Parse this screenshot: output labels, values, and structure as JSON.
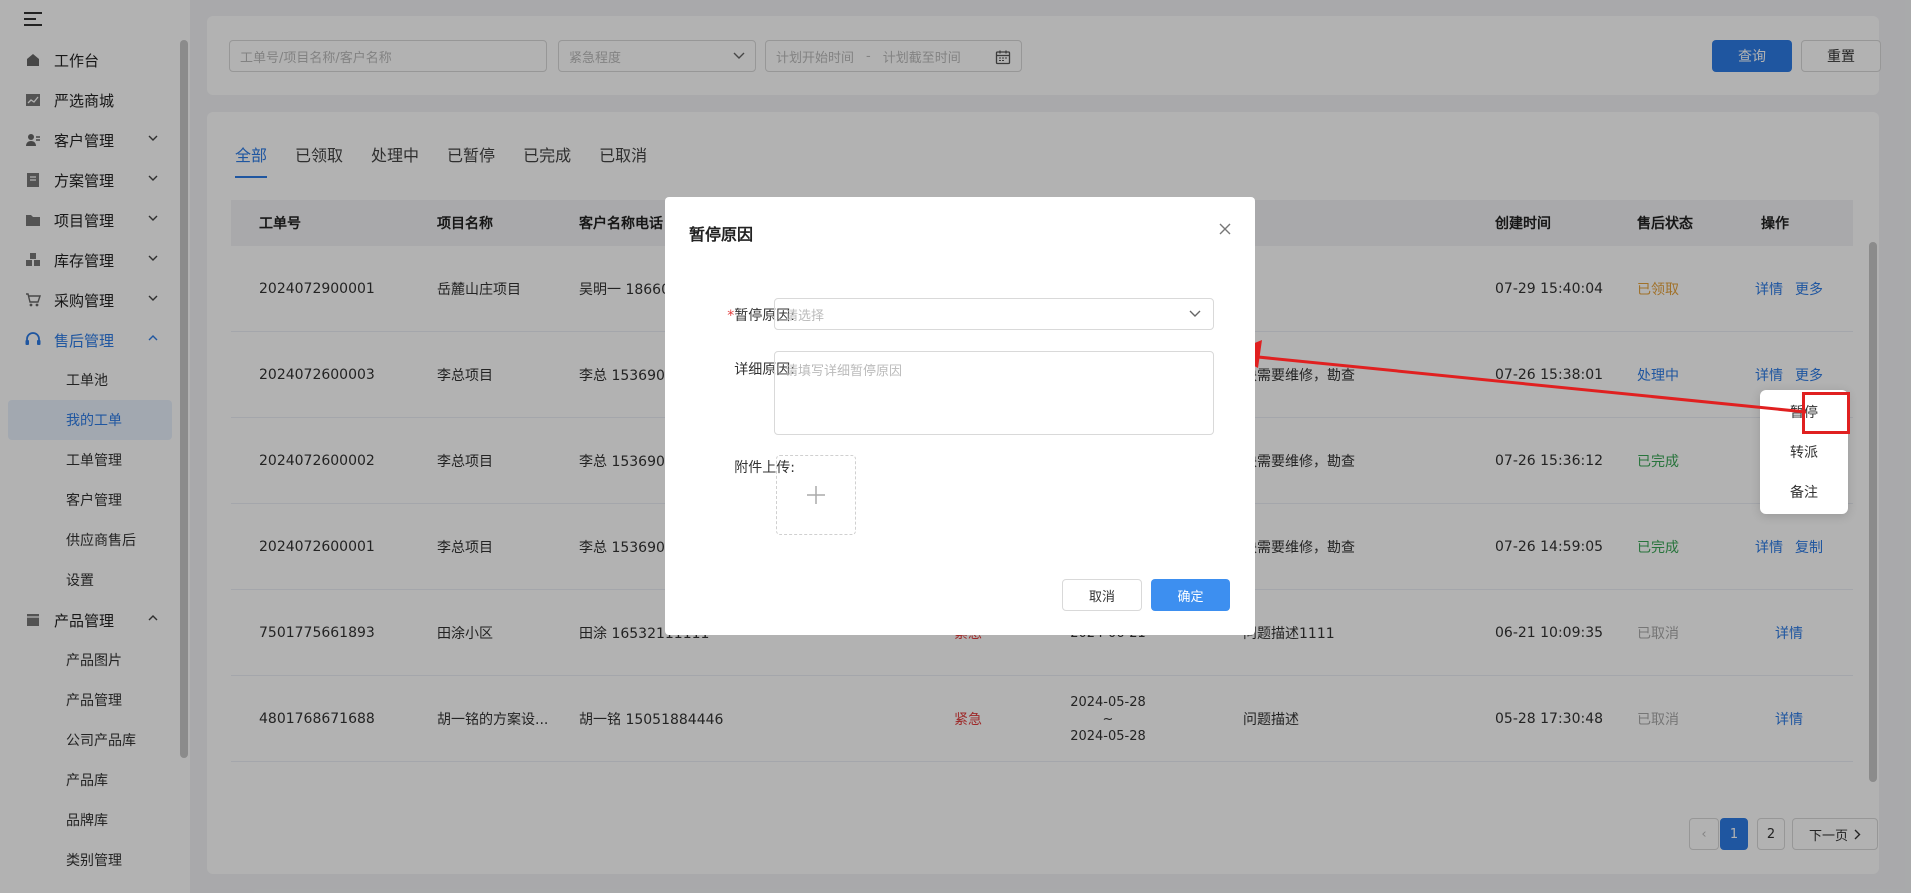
{
  "sidebar": {
    "top_items": [
      {
        "label": "工作台",
        "icon": "home-icon"
      },
      {
        "label": "严选商城",
        "icon": "chart-icon"
      },
      {
        "label": "客户管理",
        "icon": "user-icon"
      },
      {
        "label": "方案管理",
        "icon": "doc-icon"
      },
      {
        "label": "项目管理",
        "icon": "folder-icon"
      },
      {
        "label": "库存管理",
        "icon": "box-icon"
      },
      {
        "label": "采购管理",
        "icon": "cart-icon"
      },
      {
        "label": "售后管理",
        "icon": "headset-icon"
      }
    ],
    "aftersale_sub": [
      "工单池",
      "我的工单",
      "工单管理",
      "客户管理",
      "供应商售后",
      "设置"
    ],
    "product_label": "产品管理",
    "product_sub": [
      "产品图片",
      "产品管理",
      "公司产品库",
      "产品库",
      "品牌库",
      "类别管理"
    ]
  },
  "search": {
    "keyword_placeholder": "工单号/项目名称/客户名称",
    "urgency_placeholder": "紧急程度",
    "start_placeholder": "计划开始时间",
    "separator": "-",
    "end_placeholder": "计划截至时间",
    "query_label": "查询",
    "reset_label": "重置"
  },
  "tabs": [
    "全部",
    "已领取",
    "处理中",
    "已暂停",
    "已完成",
    "已取消"
  ],
  "table": {
    "headers": {
      "order_no": "工单号",
      "project": "项目名称",
      "customer": "客户名称电话",
      "created": "创建时间",
      "status": "售后状态",
      "actions": "操作"
    },
    "rows": [
      {
        "order_no": "2024072900001",
        "project": "岳麓山庄项目",
        "customer": "吴明一  18660",
        "urgency": "",
        "plan_start": "",
        "plan_end": "",
        "desc": "",
        "created": "07-29 15:40:04",
        "status": "已领取",
        "status_class": "st-orange",
        "act1": "详情",
        "act2": "更多"
      },
      {
        "order_no": "2024072600003",
        "project": "李总项目",
        "customer": "李总  153690",
        "urgency": "",
        "plan_start": "",
        "plan_end": "",
        "desc": "块需要维修，勘查",
        "created": "07-26 15:38:01",
        "status": "处理中",
        "status_class": "st-blue",
        "act1": "详情",
        "act2": "更多"
      },
      {
        "order_no": "2024072600002",
        "project": "李总项目",
        "customer": "李总  153690",
        "urgency": "",
        "plan_start": "",
        "plan_end": "",
        "desc": "块需要维修，勘查",
        "created": "07-26 15:36:12",
        "status": "已完成",
        "status_class": "st-green",
        "act1": "",
        "act2": ""
      },
      {
        "order_no": "2024072600001",
        "project": "李总项目",
        "customer": "李总  153690",
        "urgency": "",
        "plan_start": "",
        "plan_end": "",
        "desc": "块需要维修，勘查",
        "created": "07-26 14:59:05",
        "status": "已完成",
        "status_class": "st-green",
        "act1": "详情",
        "act2": "复制"
      },
      {
        "order_no": "7501775661893",
        "project": "田涂小区",
        "customer": "田涂  16532111111",
        "urgency": "紧急",
        "plan_start": "",
        "plan_end": "2024-06-21",
        "desc": "问题描述1111",
        "created": "06-21 10:09:35",
        "status": "已取消",
        "status_class": "st-gray",
        "act1": "详情",
        "act2": ""
      },
      {
        "order_no": "4801768671688",
        "project": "胡一铭的方案设...",
        "customer": "胡一铭  15051884446",
        "urgency": "紧急",
        "plan_start": "2024-05-28",
        "plan_end": "2024-05-28",
        "desc": "问题描述",
        "created": "05-28 17:30:48",
        "status": "已取消",
        "status_class": "st-gray",
        "act1": "详情",
        "act2": ""
      }
    ],
    "tilde": "~"
  },
  "pagination": {
    "prev": "‹",
    "pages": [
      "1",
      "2"
    ],
    "next": "下一页"
  },
  "dropdown": [
    "暂停",
    "转派",
    "备注"
  ],
  "modal": {
    "title": "暂停原因",
    "reason_label": "暂停原因:",
    "reason_required": "*",
    "reason_placeholder": "请选择",
    "detail_label": "详细原因:",
    "detail_placeholder": "请填写详细暂停原因",
    "upload_label": "附件上传:",
    "cancel_label": "取消",
    "confirm_label": "确定"
  },
  "colors": {
    "primary": "#2d7be5",
    "annotation": "#e02020"
  }
}
